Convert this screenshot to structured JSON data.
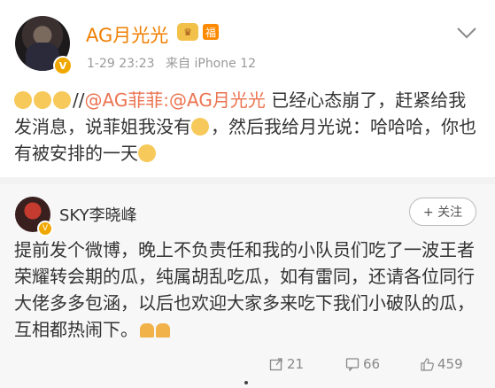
{
  "post": {
    "username": "AG月光光",
    "level_badge": "♛",
    "fan_badge": "福",
    "time": "1-29 23:23",
    "source": "来自 iPhone 12",
    "content_prefix": "//",
    "mention": "@AG菲菲:@AG月光光",
    "content_rest": " 已经心态崩了，赶紧给我发消息，说菲姐我没有",
    "content_tail": "，然后我给月光说：哈哈哈，你也有被安排的一天"
  },
  "repost": {
    "username": "SKY李晓峰",
    "follow_label": "+ 关注",
    "content": "提前发个微博，晚上不负责任和我的小队员们吃了一波王者荣耀转会期的瓜，纯属胡乱吃瓜，如有雷同，还请各位同行大佬多多包涵，以后也欢迎大家多来吃下我们小破队的瓜，互相都热闹下。",
    "shares": "21",
    "comments": "66",
    "likes": "459"
  },
  "colors": {
    "accent": "#f07f00",
    "mention": "#eb7350"
  }
}
